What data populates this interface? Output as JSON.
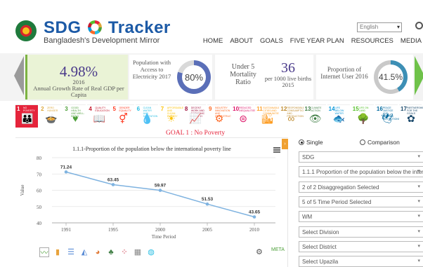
{
  "header": {
    "brand_left": "SDG",
    "brand_right": "Tracker",
    "tagline": "Bangladesh's Development Mirror",
    "language": "English",
    "nav": [
      "HOME",
      "ABOUT",
      "GOALS",
      "FIVE YEAR PLAN",
      "RESOURCES",
      "MEDIA"
    ]
  },
  "stats": {
    "gdp": {
      "value": "4.98%",
      "year": "2016",
      "label": "Annual Growth Rate of Real GDP per Capita"
    },
    "electricity": {
      "label": "Population with Access to Electricity 2017",
      "value": "80%",
      "percent": 80
    },
    "mortality": {
      "label": "Under 5 Mortality Ratio",
      "value": "36",
      "sub": "per 1000 live births 2015"
    },
    "internet": {
      "label": "Proportion of Internet User 2016",
      "value": "41.5%",
      "percent": 41.5
    }
  },
  "goals": [
    {
      "num": "1",
      "title": "No Poverty",
      "color": "#e5243b",
      "sym": "👪",
      "active": true
    },
    {
      "num": "2",
      "title": "Zero Hunger",
      "color": "#dda63a",
      "sym": "🍲"
    },
    {
      "num": "3",
      "title": "Good Health and Well-Being",
      "color": "#4c9f38",
      "sym": "♥"
    },
    {
      "num": "4",
      "title": "Quality Education",
      "color": "#c5192d",
      "sym": "📖"
    },
    {
      "num": "5",
      "title": "Gender Equality",
      "color": "#ff3a21",
      "sym": "⚥"
    },
    {
      "num": "6",
      "title": "Clean Water and Sanitation",
      "color": "#26bde2",
      "sym": "💧"
    },
    {
      "num": "7",
      "title": "Affordable and Clean Energy",
      "color": "#fcc30b",
      "sym": "☀"
    },
    {
      "num": "8",
      "title": "Decent Work and Economic Growth",
      "color": "#a21942",
      "sym": "📈"
    },
    {
      "num": "9",
      "title": "Industry Innovation and Infrastructure",
      "color": "#fd6925",
      "sym": "⚙"
    },
    {
      "num": "10",
      "title": "Reduced Inequalities",
      "color": "#dd1367",
      "sym": "⊜"
    },
    {
      "num": "11",
      "title": "Sustainable Cities and Communities",
      "color": "#fd9d24",
      "sym": "🏙"
    },
    {
      "num": "12",
      "title": "Responsible Consumption and Production",
      "color": "#bf8b2e",
      "sym": "∞"
    },
    {
      "num": "13",
      "title": "Climate Action",
      "color": "#3f7e44",
      "sym": "👁"
    },
    {
      "num": "14",
      "title": "Life Below Water",
      "color": "#0a97d9",
      "sym": "🐟"
    },
    {
      "num": "15",
      "title": "Life on Land",
      "color": "#56c02b",
      "sym": "🌳"
    },
    {
      "num": "16",
      "title": "Peace Justice and Strong Institutions",
      "color": "#00689d",
      "sym": "🕊"
    },
    {
      "num": "17",
      "title": "Partnerships for the Goals",
      "color": "#19486a",
      "sym": "✿"
    }
  ],
  "goal_title": "GOAL 1 : No Poverty",
  "filters": {
    "single": "Single",
    "comparison": "Comparison",
    "items": [
      "SDG",
      "1.1.1 Proportion of the population below the interna",
      "2 of 2 Disaggregation Selected",
      "5 of 5 Time Period Selected",
      "WM",
      "Select Division",
      "Select District",
      "Select Upazila"
    ]
  },
  "chart_data": {
    "type": "line",
    "title": "1.1.1-Proportion of the population below the international poverty line",
    "xlabel": "Time Period",
    "ylabel": "Value",
    "categories": [
      "1991",
      "1995",
      "2000",
      "2005",
      "2010"
    ],
    "values": [
      71.24,
      63.45,
      59.97,
      51.53,
      43.65
    ],
    "data_labels": [
      "71.24",
      "63.45",
      "59.97",
      "51.53",
      "43.65"
    ],
    "yticks": [
      40,
      50,
      60,
      70,
      80
    ],
    "ylim": [
      40,
      80
    ],
    "grid": true,
    "color": "#7fb3e0"
  }
}
